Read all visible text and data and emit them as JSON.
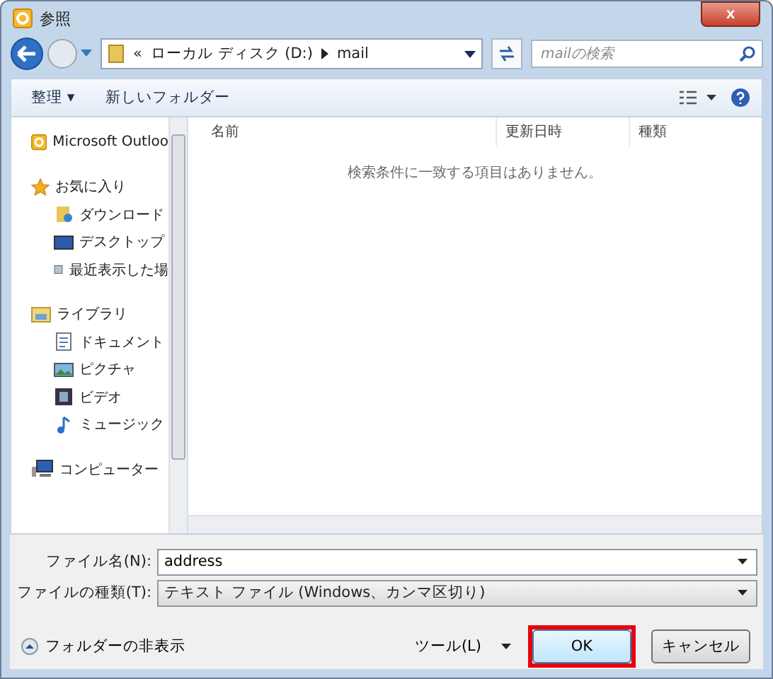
{
  "window": {
    "title": "参照",
    "close": "x"
  },
  "address": {
    "overflow": "«",
    "segments": [
      "ローカル ディスク (D:)",
      "mail"
    ]
  },
  "search": {
    "placeholder": "mailの検索"
  },
  "toolbar": {
    "organize": "整理 ▾",
    "new_folder": "新しいフォルダー"
  },
  "sidebar": {
    "items": [
      {
        "label": "Microsoft Outloo"
      },
      {
        "label": "お気に入り",
        "children": [
          {
            "label": "ダウンロード"
          },
          {
            "label": "デスクトップ"
          },
          {
            "label": "最近表示した場"
          }
        ]
      },
      {
        "label": "ライブラリ",
        "children": [
          {
            "label": "ドキュメント"
          },
          {
            "label": "ピクチャ"
          },
          {
            "label": "ビデオ"
          },
          {
            "label": "ミュージック"
          }
        ]
      },
      {
        "label": "コンピューター"
      }
    ]
  },
  "table": {
    "columns": [
      "名前",
      "更新日時",
      "種類"
    ],
    "empty_message": "検索条件に一致する項目はありません。"
  },
  "file_name": {
    "label": "ファイル名(N):",
    "value": "address"
  },
  "file_type": {
    "label": "ファイルの種類(T):",
    "value": "テキスト ファイル (Windows、カンマ区切り)"
  },
  "hide_folders": "フォルダーの非表示",
  "tools": "ツール(L)",
  "buttons": [
    {
      "label": "OK",
      "highlighted": true
    },
    {
      "label": "キャンセル",
      "highlighted": false
    }
  ]
}
